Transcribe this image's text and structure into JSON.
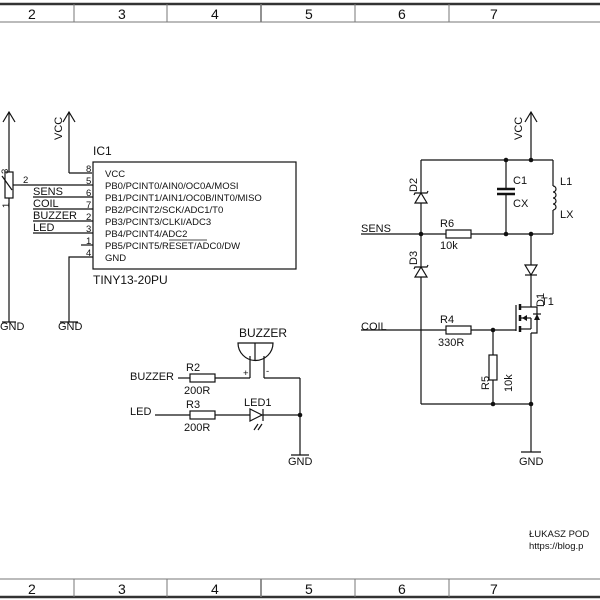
{
  "frame": {
    "zones": [
      "2",
      "3",
      "4",
      "5",
      "6",
      "7"
    ]
  },
  "power": {
    "vcc": "VCC",
    "gnd": "GND"
  },
  "pot": {
    "pin1": "1",
    "pin2": "2",
    "pin3": "3"
  },
  "ic1": {
    "ref": "IC1",
    "part": "TINY13-20PU",
    "pins": [
      {
        "num": "8",
        "name": "VCC"
      },
      {
        "num": "5",
        "name": "PB0/PCINT0/AIN0/OC0A/MOSI"
      },
      {
        "num": "6",
        "name": "PB1/PCINT1/AIN1/OC0B/INT0/MISO"
      },
      {
        "num": "7",
        "name": "PB2/PCINT2/SCK/ADC1/T0"
      },
      {
        "num": "2",
        "name": "PB3/PCINT3/CLKI/ADC3"
      },
      {
        "num": "3",
        "name": "PB4/PCINT4/ADC2"
      },
      {
        "num": "1",
        "name": "PB5/PCINT5/RESET/ADC0/DW"
      },
      {
        "num": "4",
        "name": "GND"
      }
    ]
  },
  "nets": {
    "sens": "SENS",
    "coil": "COIL",
    "buzzer": "BUZZER",
    "led": "LED"
  },
  "components": {
    "r2": {
      "ref": "R2",
      "value": "200R"
    },
    "r3": {
      "ref": "R3",
      "value": "200R"
    },
    "r4": {
      "ref": "R4",
      "value": "330R"
    },
    "r5": {
      "ref": "R5",
      "value": "10k"
    },
    "r6": {
      "ref": "R6",
      "value": "10k"
    },
    "c1": {
      "ref": "C1",
      "value": "CX"
    },
    "l1": {
      "ref": "L1",
      "value": "LX"
    },
    "d1": {
      "ref": "D1"
    },
    "d2": {
      "ref": "D2"
    },
    "d3": {
      "ref": "D3"
    },
    "t1": {
      "ref": "T1"
    },
    "led1": {
      "ref": "LED1"
    },
    "buzzer": {
      "ref": "BUZZER",
      "plus": "+",
      "minus": "-"
    }
  },
  "author": {
    "name": "ŁUKASZ POD",
    "url": "https://blog.p"
  }
}
